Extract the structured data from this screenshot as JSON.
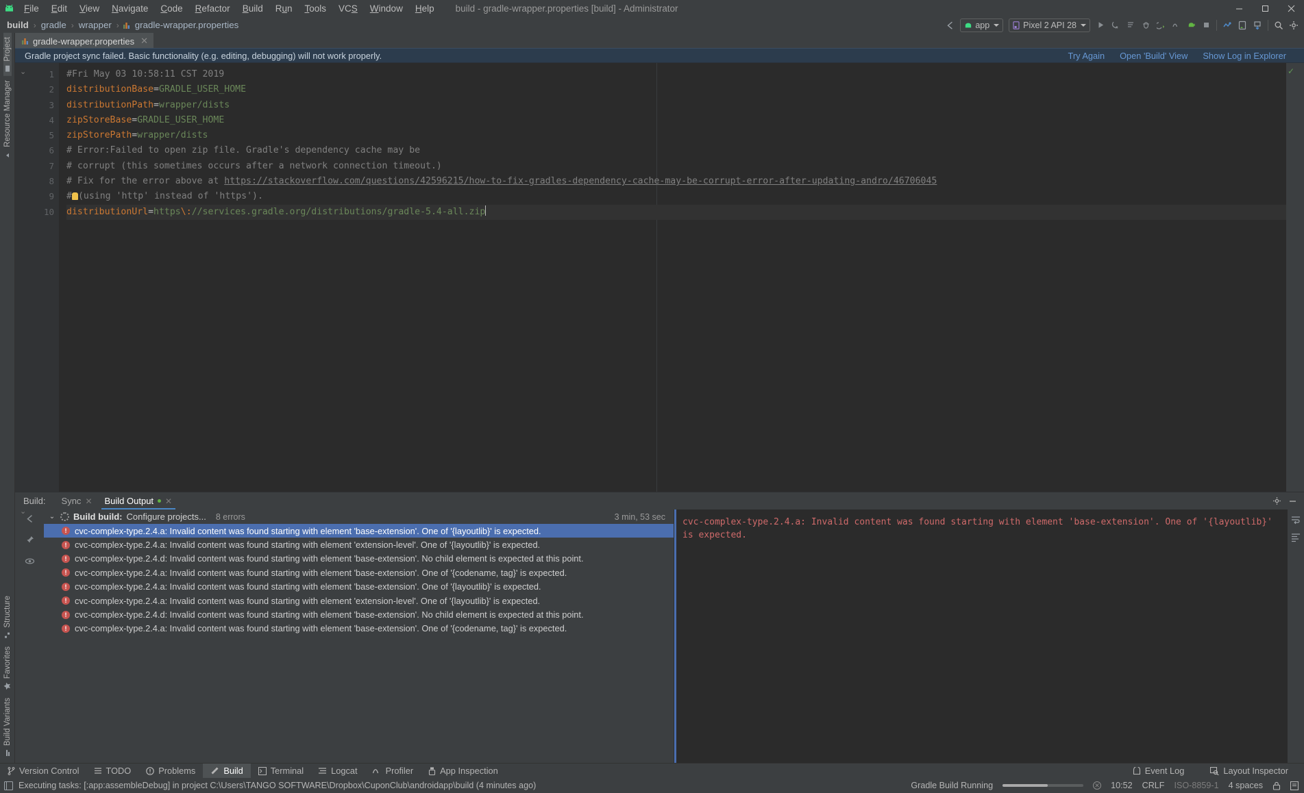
{
  "window": {
    "title": "build - gradle-wrapper.properties [build] - Administrator",
    "minimize": "—",
    "maximize": "❐",
    "close": "✕"
  },
  "menu": {
    "items": [
      "File",
      "Edit",
      "View",
      "Navigate",
      "Code",
      "Refactor",
      "Build",
      "Run",
      "Tools",
      "VCS",
      "Window",
      "Help"
    ]
  },
  "breadcrumb": {
    "items": [
      "build",
      "gradle",
      "wrapper",
      "gradle-wrapper.properties"
    ],
    "separator": "›"
  },
  "toolbar": {
    "back_arrow": "sync-arrow",
    "module_combo": "app",
    "device_combo": "Pixel 2 API 28",
    "icons": [
      "run-icon",
      "debug-attach-icon",
      "run-with-coverage-icon",
      "debug-icon",
      "step-icon",
      "profile-icon",
      "apply-changes-icon",
      "stop-icon",
      "sdk-manager-icon",
      "avd-manager-icon",
      "sync-gradle-icon",
      "search-icon",
      "settings-icon"
    ]
  },
  "editor_tabs": [
    {
      "label": "gradle-wrapper.properties",
      "close": "✕",
      "icon": "properties-file-icon",
      "active": true
    }
  ],
  "banner": {
    "message": "Gradle project sync failed. Basic functionality (e.g. editing, debugging) will not work properly.",
    "actions": [
      "Try Again",
      "Open 'Build' View",
      "Show Log in Explorer"
    ]
  },
  "editor": {
    "line_numbers": [
      "1",
      "2",
      "3",
      "4",
      "5",
      "6",
      "7",
      "8",
      "9",
      "10"
    ],
    "lines": [
      {
        "n": 1,
        "segments": [
          {
            "t": "#Fri May 03 10:58:11 CST 2019",
            "c": "cm"
          }
        ]
      },
      {
        "n": 2,
        "segments": [
          {
            "t": "distributionBase",
            "c": "k"
          },
          {
            "t": "=",
            "c": "p"
          },
          {
            "t": "GRADLE_USER_HOME",
            "c": "v"
          }
        ]
      },
      {
        "n": 3,
        "segments": [
          {
            "t": "distributionPath",
            "c": "k"
          },
          {
            "t": "=",
            "c": "p"
          },
          {
            "t": "wrapper/dists",
            "c": "v"
          }
        ]
      },
      {
        "n": 4,
        "segments": [
          {
            "t": "zipStoreBase",
            "c": "k"
          },
          {
            "t": "=",
            "c": "p"
          },
          {
            "t": "GRADLE_USER_HOME",
            "c": "v"
          }
        ]
      },
      {
        "n": 5,
        "segments": [
          {
            "t": "zipStorePath",
            "c": "k"
          },
          {
            "t": "=",
            "c": "p"
          },
          {
            "t": "wrapper/dists",
            "c": "v"
          }
        ]
      },
      {
        "n": 6,
        "segments": [
          {
            "t": "# Error:Failed to open zip file. Gradle's dependency cache may be",
            "c": "cm"
          }
        ]
      },
      {
        "n": 7,
        "segments": [
          {
            "t": "# corrupt (this sometimes occurs after a network connection timeout.)",
            "c": "cm"
          }
        ]
      },
      {
        "n": 8,
        "segments": [
          {
            "t": "# Fix for the error above at ",
            "c": "cm"
          },
          {
            "t": "https://stackoverflow.com/questions/42596215/how-to-fix-gradles-dependency-cache-may-be-corrupt-error-after-updating-andro/46706045",
            "c": "lnk"
          }
        ]
      },
      {
        "n": 9,
        "segments": [
          {
            "t": "#",
            "c": "cm"
          },
          {
            "t": "BULB",
            "c": "bulb"
          },
          {
            "t": "(using 'http' instead of 'https').",
            "c": "cm"
          }
        ]
      },
      {
        "n": 10,
        "segments": [
          {
            "t": "distributionUrl",
            "c": "k"
          },
          {
            "t": "=",
            "c": "p"
          },
          {
            "t": "https",
            "c": "v"
          },
          {
            "t": "\\:",
            "c": "esc"
          },
          {
            "t": "//services.gradle.org/distributions/gradle-5.4-all.zip",
            "c": "v"
          }
        ]
      }
    ],
    "inspection_status": "✓"
  },
  "build_window": {
    "label": "Build:",
    "tabs": [
      {
        "label": "Sync",
        "close": "✕",
        "active": false
      },
      {
        "label": "Build Output",
        "close": "✕",
        "active": true
      }
    ],
    "header_icons": [
      "settings-icon",
      "minimize-icon"
    ],
    "side_icons": [
      "collapse-arrow-icon",
      "pin-icon",
      "eye-icon"
    ],
    "tree": {
      "expand_chevron": "⌄",
      "root_title": "Build build:",
      "root_subtitle": "Configure projects...",
      "error_count": "8 errors",
      "duration": "3 min, 53 sec",
      "errors": [
        {
          "text": "cvc-complex-type.2.4.a: Invalid content was found starting with element 'base-extension'. One of '{layoutlib}' is expected.",
          "selected": true
        },
        {
          "text": "cvc-complex-type.2.4.a: Invalid content was found starting with element 'extension-level'. One of '{layoutlib}' is expected.",
          "selected": false
        },
        {
          "text": "cvc-complex-type.2.4.d: Invalid content was found starting with element 'base-extension'. No child element is expected at this point.",
          "selected": false
        },
        {
          "text": "cvc-complex-type.2.4.a: Invalid content was found starting with element 'base-extension'. One of '{codename, tag}' is expected.",
          "selected": false
        },
        {
          "text": "cvc-complex-type.2.4.a: Invalid content was found starting with element 'base-extension'. One of '{layoutlib}' is expected.",
          "selected": false
        },
        {
          "text": "cvc-complex-type.2.4.a: Invalid content was found starting with element 'extension-level'. One of '{layoutlib}' is expected.",
          "selected": false
        },
        {
          "text": "cvc-complex-type.2.4.d: Invalid content was found starting with element 'base-extension'. No child element is expected at this point.",
          "selected": false
        },
        {
          "text": "cvc-complex-type.2.4.a: Invalid content was found starting with element 'base-extension'. One of '{codename, tag}' is expected.",
          "selected": false
        }
      ]
    },
    "console": {
      "text": "cvc-complex-type.2.4.a: Invalid content was found starting with element 'base-extension'. One of '{layoutlib}' is expected.",
      "side_icons": [
        "soft-wrap-icon",
        "scroll-to-end-icon"
      ]
    }
  },
  "left_strip": {
    "top": [
      {
        "label": "Project",
        "icon": "project-icon",
        "selected": true
      },
      {
        "label": "Resource Manager",
        "icon": "resource-manager-icon",
        "selected": false
      }
    ],
    "bottom": [
      {
        "label": "Structure",
        "icon": "structure-icon",
        "selected": false
      },
      {
        "label": "Favorites",
        "icon": "favorites-icon",
        "selected": false
      },
      {
        "label": "Build Variants",
        "icon": "build-variants-icon",
        "selected": false
      }
    ]
  },
  "bottom_tabs": [
    {
      "label": "Version Control",
      "icon": "version-control-icon",
      "selected": false
    },
    {
      "label": "TODO",
      "icon": "todo-icon",
      "selected": false
    },
    {
      "label": "Problems",
      "icon": "problems-icon",
      "selected": false
    },
    {
      "label": "Build",
      "icon": "build-hammer-icon",
      "selected": true
    },
    {
      "label": "Terminal",
      "icon": "terminal-icon",
      "selected": false
    },
    {
      "label": "Logcat",
      "icon": "logcat-icon",
      "selected": false
    },
    {
      "label": "Profiler",
      "icon": "profiler-icon",
      "selected": false
    },
    {
      "label": "App Inspection",
      "icon": "app-inspection-icon",
      "selected": false
    }
  ],
  "bottom_right_tabs": [
    {
      "label": "Event Log",
      "icon": "event-log-icon"
    },
    {
      "label": "Layout Inspector",
      "icon": "layout-inspector-icon"
    }
  ],
  "status_bar": {
    "message": "Executing tasks: [:app:assembleDebug] in project C:\\Users\\TANGO SOFTWARE\\Dropbox\\CuponClub\\androidapp\\build (4 minutes ago)",
    "progress_label": "Gradle Build Running",
    "progress_cancel": "✕",
    "time": "10:52",
    "line_separator": "CRLF",
    "encoding": "ISO-8859-1",
    "indent": "4 spaces",
    "lock_icon": "lock-icon",
    "notifications_icon": "notifications-icon"
  },
  "colors": {
    "accent_blue": "#4b6eaf",
    "banner_bg": "#2c3c4d",
    "link_blue": "#6798d4",
    "error_red": "#c75450",
    "console_red": "#cf6a6a",
    "editor_bg": "#2b2b2b",
    "chrome_bg": "#3c3f41",
    "keyword_orange": "#cc7832",
    "value_green": "#6a8759",
    "comment_gray": "#808080",
    "android_green": "#3ddc84"
  }
}
